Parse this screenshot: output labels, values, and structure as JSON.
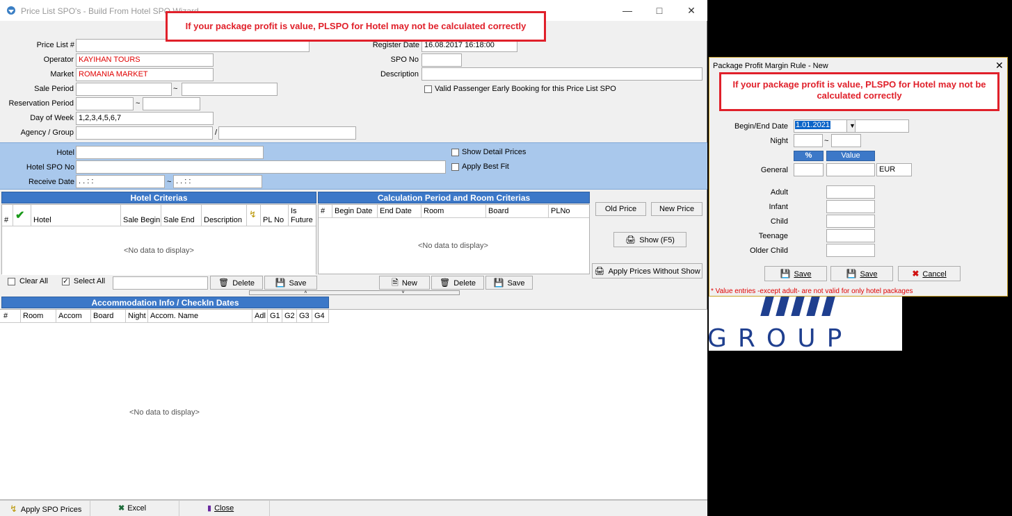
{
  "main": {
    "title": "Price List SPO's - Build From Hotel SPO Wizard",
    "alert": "If your package profit is value, PLSPO for Hotel may not be calculated correctly",
    "form": {
      "price_list_label": "Price List #",
      "operator_label": "Operator",
      "operator_value": "KAYIHAN TOURS",
      "market_label": "Market",
      "market_value": "ROMANIA MARKET",
      "sale_period_label": "Sale Period",
      "reservation_period_label": "Reservation Period",
      "day_of_week_label": "Day of Week",
      "day_of_week_value": "1,2,3,4,5,6,7",
      "agency_group_label": "Agency / Group",
      "register_date_label": "Register Date",
      "register_date_value": "16.08.2017 16:18:00",
      "spo_no_label": "SPO No",
      "description_label": "Description",
      "valid_passenger_label": "Valid Passenger Early Booking for this Price List SPO",
      "tilde": "~",
      "slash": "/"
    },
    "hotel_panel": {
      "hotel_label": "Hotel",
      "hotel_spo_no_label": "Hotel SPO No",
      "receive_date_label": "Receive Date",
      "receive_date_from": " .  .       :  :",
      "receive_date_to": " .  .       :  :",
      "show_detail_prices": "Show Detail Prices",
      "apply_best_fit": "Apply Best Fit"
    },
    "hotel_criterias": {
      "header": "Hotel Criterias",
      "columns": [
        "#",
        "",
        "Hotel",
        "Sale Begin",
        "Sale End",
        "Description",
        "",
        "PL No",
        "Is Future"
      ],
      "no_data": "<No data to display>",
      "clear_all": "Clear All",
      "select_all": "Select All",
      "delete": "Delete",
      "save": "Save"
    },
    "calc_period": {
      "header": "Calculation Period and Room Criterias",
      "columns": [
        "#",
        "Begin Date",
        "End Date",
        "Room",
        "Board",
        "PLNo"
      ],
      "no_data": "<No data to display>",
      "new": "New",
      "delete": "Delete",
      "save": "Save"
    },
    "side_buttons": {
      "old_price": "Old Price",
      "new_price": "New Price",
      "show": "Show (F5)",
      "apply_without_show": "Apply Prices Without Show"
    },
    "accommodation": {
      "header": "Accommodation Info / CheckIn Dates",
      "columns": [
        "#",
        "Room",
        "Accom",
        "Board",
        "Night",
        "Accom. Name",
        "Adl",
        "G1",
        "G2",
        "G3",
        "G4"
      ],
      "no_data": "<No data to display>"
    },
    "bottom": {
      "apply_spo_prices": "Apply SPO Prices",
      "excel": "Excel",
      "close": "Close"
    }
  },
  "rule_window": {
    "title": "Package Profit Margin Rule - New",
    "alert": "If your package profit is value, PLSPO for Hotel may not be calculated correctly",
    "begin_end_label": "Begin/End Date",
    "begin_value": "1.01.2021",
    "night_label": "Night",
    "pct_header": "%",
    "value_header": "Value",
    "general_label": "General",
    "currency": "EUR",
    "adult_label": "Adult",
    "infant_label": "Infant",
    "child_label": "Child",
    "teenage_label": "Teenage",
    "older_child_label": "Older Child",
    "save1": "Save",
    "save2": "Save",
    "cancel": "Cancel",
    "note": "* Value entries -except adult- are not valid for only hotel packages",
    "tilde": "~"
  },
  "background_logo": {
    "text": "GROUP"
  },
  "colors": {
    "accent_blue": "#3c78c8",
    "alert_red": "#e0202a",
    "panel_blue": "#a9c8ec"
  }
}
